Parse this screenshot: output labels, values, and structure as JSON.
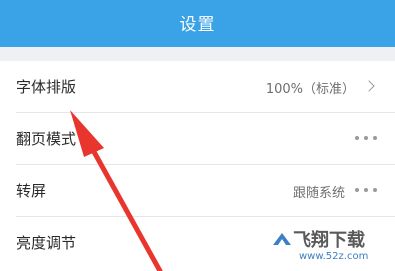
{
  "header": {
    "title": "设置"
  },
  "settings": {
    "items": [
      {
        "label": "字体排版",
        "value": "100%（标准）",
        "control": "chevron-icon"
      },
      {
        "label": "翻页模式",
        "value": "",
        "control": "more-icon"
      },
      {
        "label": "转屏",
        "value": "跟随系统",
        "control": "more-icon"
      },
      {
        "label": "亮度调节",
        "value": "",
        "control": "none"
      }
    ]
  },
  "watermark": {
    "title": "飞翔下载",
    "url": "www.52z.com"
  },
  "colors": {
    "header_bg": "#3aa2e6",
    "section_gap": "#eef0f3",
    "annotation_arrow": "#e8362e",
    "watermark_url": "#3b7fc4"
  }
}
